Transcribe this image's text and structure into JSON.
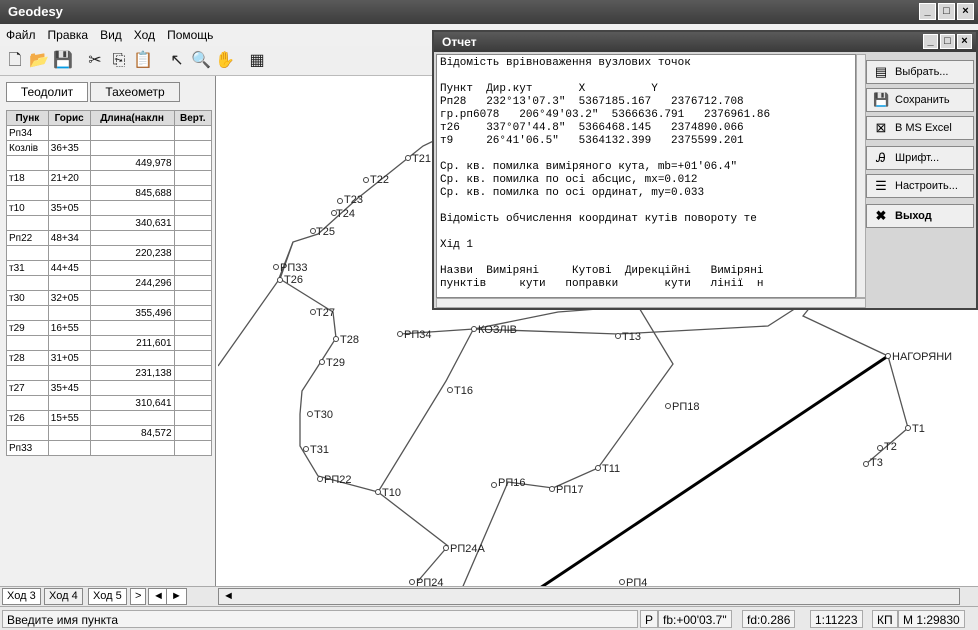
{
  "app": {
    "title": "Geodesy"
  },
  "menu": [
    "Файл",
    "Правка",
    "Вид",
    "Ход",
    "Помощь"
  ],
  "left_tabs": [
    "Теодолит",
    "Тахеометр"
  ],
  "grid": {
    "headers": [
      "Пунк",
      "Горис",
      "Длина(наклн",
      "Верт."
    ],
    "rows": [
      [
        "Рп34",
        "",
        "",
        ""
      ],
      [
        "Козлів",
        "36+35",
        "",
        ""
      ],
      [
        "",
        "",
        "449,978",
        ""
      ],
      [
        "т18",
        "21+20",
        "",
        ""
      ],
      [
        "",
        "",
        "845,688",
        ""
      ],
      [
        "т10",
        "35+05",
        "",
        ""
      ],
      [
        "",
        "",
        "340,631",
        ""
      ],
      [
        "Рп22",
        "48+34",
        "",
        ""
      ],
      [
        "",
        "",
        "220,238",
        ""
      ],
      [
        "т31",
        "44+45",
        "",
        ""
      ],
      [
        "",
        "",
        "244,296",
        ""
      ],
      [
        "т30",
        "32+05",
        "",
        ""
      ],
      [
        "",
        "",
        "355,496",
        ""
      ],
      [
        "т29",
        "16+55",
        "",
        ""
      ],
      [
        "",
        "",
        "211,601",
        ""
      ],
      [
        "т28",
        "31+05",
        "",
        ""
      ],
      [
        "",
        "",
        "231,138",
        ""
      ],
      [
        "т27",
        "35+45",
        "",
        ""
      ],
      [
        "",
        "",
        "310,641",
        ""
      ],
      [
        "т26",
        "15+55",
        "",
        ""
      ],
      [
        "",
        "",
        "84,572",
        ""
      ],
      [
        "Рп33",
        "",
        "",
        ""
      ]
    ]
  },
  "map_labels": {
    "t21": "Т21",
    "t22": "Т22",
    "t23": "Т23",
    "t24": "Т24",
    "t25": "Т25",
    "rp33": "РП33",
    "t26": "Т26",
    "t27": "Т27",
    "t28": "Т28",
    "rp34": "РП34",
    "kozliv": "КОЗЛІВ",
    "t13": "Т13",
    "nahoriany": "НАГОРЯНИ",
    "t1": "Т1",
    "t2": "Т2",
    "t3": "Т3",
    "t29": "Т29",
    "t16": "Т16",
    "rp18": "РП18",
    "t30": "Т30",
    "t31": "Т31",
    "rp22": "РП22",
    "t10": "Т10",
    "t11": "Т11",
    "rp16": "РП16",
    "rp17": "РП17",
    "rp24a": "РП24А",
    "rp24": "РП24",
    "rp4": "РП4"
  },
  "report": {
    "title": "Отчет",
    "lines": [
      "Відомість врівноваження вузлових точок",
      "",
      "Пункт  Дир.кут       X          Y",
      "Рп28   232°13'07.3\"  5367185.167   2376712.708",
      "гр.рп6078   206°49'03.2\"  5366636.791   2376961.86",
      "т26    337°07'44.8\"  5366468.145   2374890.066",
      "т9     26°41'06.5\"   5364132.399   2375599.201",
      "",
      "Ср. кв. помилка виміряного кута, mb=+01'06.4\"",
      "Ср. кв. помилка по осі абсцис, mx=0.012",
      "Ср. кв. помилка по осі ординат, my=0.033",
      "",
      "Відомість обчислення координат кутів повороту те",
      "",
      "Хід 1",
      "",
      "Назви  Виміряні     Кутові  Дирекційні   Виміряні",
      "пунктів     кути   поправки       кути   лінії  н"
    ],
    "buttons": [
      "Выбрать...",
      "Сохранить",
      "В MS Excel",
      "Шрифт...",
      "Настроить...",
      "Выход"
    ]
  },
  "bottom_tabs": [
    "Ход 3",
    "Ход 4",
    "Ход 5"
  ],
  "status": {
    "hint": "Введите имя пункта",
    "p": "P",
    "fb": "fb:+00'03.7\"",
    "fd": "fd:0.286",
    "ratio": "1:11223",
    "kp": "КП",
    "scale": "М 1:29830"
  }
}
